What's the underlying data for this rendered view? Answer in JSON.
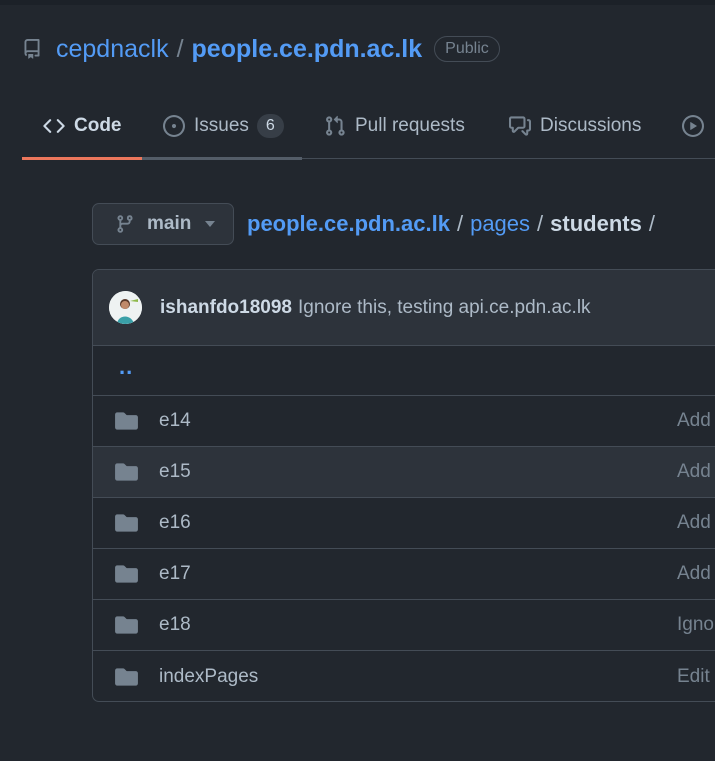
{
  "repo": {
    "owner": "cepdnaclk",
    "separator": "/",
    "name": "people.ce.pdn.ac.lk",
    "visibility": "Public"
  },
  "tabs": [
    {
      "label": "Code",
      "icon": "code-icon",
      "active": true
    },
    {
      "label": "Issues",
      "icon": "issue-opened-icon",
      "count": "6"
    },
    {
      "label": "Pull requests",
      "icon": "git-pull-request-icon"
    },
    {
      "label": "Discussions",
      "icon": "comment-discussion-icon"
    }
  ],
  "branch": {
    "name": "main"
  },
  "breadcrumb": {
    "root": "people.ce.pdn.ac.lk",
    "sep": "/",
    "folder": "pages",
    "current": "students",
    "trailing": "/"
  },
  "commit": {
    "author": "ishanfdo18098",
    "message": "Ignore this, testing api.ce.pdn.ac.lk"
  },
  "parent_link": "..",
  "files": [
    {
      "name": "e14",
      "commit": "Add"
    },
    {
      "name": "e15",
      "commit": "Add"
    },
    {
      "name": "e16",
      "commit": "Add"
    },
    {
      "name": "e17",
      "commit": "Add"
    },
    {
      "name": "e18",
      "commit": "Igno"
    },
    {
      "name": "indexPages",
      "commit": "Edit"
    }
  ],
  "colors": {
    "background": "#22272e",
    "link": "#539bf5",
    "tab_underline": "#ec775c",
    "border": "#444c56"
  }
}
